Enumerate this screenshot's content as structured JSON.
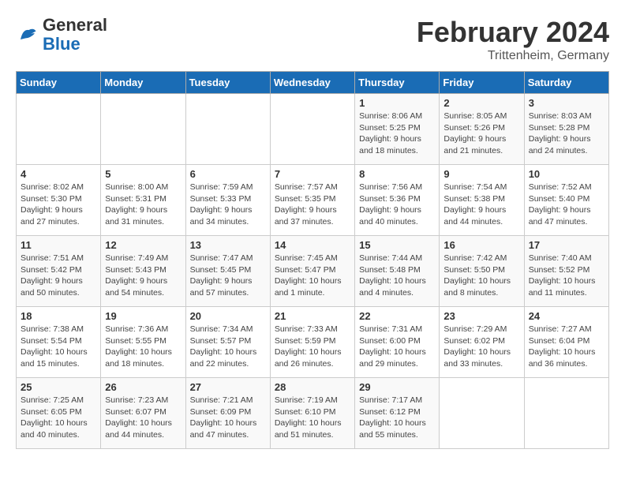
{
  "logo": {
    "text_general": "General",
    "text_blue": "Blue"
  },
  "header": {
    "title": "February 2024",
    "subtitle": "Trittenheim, Germany"
  },
  "weekdays": [
    "Sunday",
    "Monday",
    "Tuesday",
    "Wednesday",
    "Thursday",
    "Friday",
    "Saturday"
  ],
  "weeks": [
    [
      {
        "day": "",
        "info": ""
      },
      {
        "day": "",
        "info": ""
      },
      {
        "day": "",
        "info": ""
      },
      {
        "day": "",
        "info": ""
      },
      {
        "day": "1",
        "info": "Sunrise: 8:06 AM\nSunset: 5:25 PM\nDaylight: 9 hours\nand 18 minutes."
      },
      {
        "day": "2",
        "info": "Sunrise: 8:05 AM\nSunset: 5:26 PM\nDaylight: 9 hours\nand 21 minutes."
      },
      {
        "day": "3",
        "info": "Sunrise: 8:03 AM\nSunset: 5:28 PM\nDaylight: 9 hours\nand 24 minutes."
      }
    ],
    [
      {
        "day": "4",
        "info": "Sunrise: 8:02 AM\nSunset: 5:30 PM\nDaylight: 9 hours\nand 27 minutes."
      },
      {
        "day": "5",
        "info": "Sunrise: 8:00 AM\nSunset: 5:31 PM\nDaylight: 9 hours\nand 31 minutes."
      },
      {
        "day": "6",
        "info": "Sunrise: 7:59 AM\nSunset: 5:33 PM\nDaylight: 9 hours\nand 34 minutes."
      },
      {
        "day": "7",
        "info": "Sunrise: 7:57 AM\nSunset: 5:35 PM\nDaylight: 9 hours\nand 37 minutes."
      },
      {
        "day": "8",
        "info": "Sunrise: 7:56 AM\nSunset: 5:36 PM\nDaylight: 9 hours\nand 40 minutes."
      },
      {
        "day": "9",
        "info": "Sunrise: 7:54 AM\nSunset: 5:38 PM\nDaylight: 9 hours\nand 44 minutes."
      },
      {
        "day": "10",
        "info": "Sunrise: 7:52 AM\nSunset: 5:40 PM\nDaylight: 9 hours\nand 47 minutes."
      }
    ],
    [
      {
        "day": "11",
        "info": "Sunrise: 7:51 AM\nSunset: 5:42 PM\nDaylight: 9 hours\nand 50 minutes."
      },
      {
        "day": "12",
        "info": "Sunrise: 7:49 AM\nSunset: 5:43 PM\nDaylight: 9 hours\nand 54 minutes."
      },
      {
        "day": "13",
        "info": "Sunrise: 7:47 AM\nSunset: 5:45 PM\nDaylight: 9 hours\nand 57 minutes."
      },
      {
        "day": "14",
        "info": "Sunrise: 7:45 AM\nSunset: 5:47 PM\nDaylight: 10 hours\nand 1 minute."
      },
      {
        "day": "15",
        "info": "Sunrise: 7:44 AM\nSunset: 5:48 PM\nDaylight: 10 hours\nand 4 minutes."
      },
      {
        "day": "16",
        "info": "Sunrise: 7:42 AM\nSunset: 5:50 PM\nDaylight: 10 hours\nand 8 minutes."
      },
      {
        "day": "17",
        "info": "Sunrise: 7:40 AM\nSunset: 5:52 PM\nDaylight: 10 hours\nand 11 minutes."
      }
    ],
    [
      {
        "day": "18",
        "info": "Sunrise: 7:38 AM\nSunset: 5:54 PM\nDaylight: 10 hours\nand 15 minutes."
      },
      {
        "day": "19",
        "info": "Sunrise: 7:36 AM\nSunset: 5:55 PM\nDaylight: 10 hours\nand 18 minutes."
      },
      {
        "day": "20",
        "info": "Sunrise: 7:34 AM\nSunset: 5:57 PM\nDaylight: 10 hours\nand 22 minutes."
      },
      {
        "day": "21",
        "info": "Sunrise: 7:33 AM\nSunset: 5:59 PM\nDaylight: 10 hours\nand 26 minutes."
      },
      {
        "day": "22",
        "info": "Sunrise: 7:31 AM\nSunset: 6:00 PM\nDaylight: 10 hours\nand 29 minutes."
      },
      {
        "day": "23",
        "info": "Sunrise: 7:29 AM\nSunset: 6:02 PM\nDaylight: 10 hours\nand 33 minutes."
      },
      {
        "day": "24",
        "info": "Sunrise: 7:27 AM\nSunset: 6:04 PM\nDaylight: 10 hours\nand 36 minutes."
      }
    ],
    [
      {
        "day": "25",
        "info": "Sunrise: 7:25 AM\nSunset: 6:05 PM\nDaylight: 10 hours\nand 40 minutes."
      },
      {
        "day": "26",
        "info": "Sunrise: 7:23 AM\nSunset: 6:07 PM\nDaylight: 10 hours\nand 44 minutes."
      },
      {
        "day": "27",
        "info": "Sunrise: 7:21 AM\nSunset: 6:09 PM\nDaylight: 10 hours\nand 47 minutes."
      },
      {
        "day": "28",
        "info": "Sunrise: 7:19 AM\nSunset: 6:10 PM\nDaylight: 10 hours\nand 51 minutes."
      },
      {
        "day": "29",
        "info": "Sunrise: 7:17 AM\nSunset: 6:12 PM\nDaylight: 10 hours\nand 55 minutes."
      },
      {
        "day": "",
        "info": ""
      },
      {
        "day": "",
        "info": ""
      }
    ]
  ]
}
